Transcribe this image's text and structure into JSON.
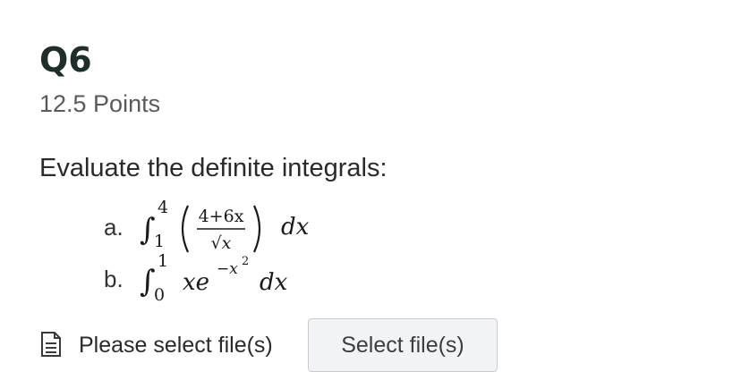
{
  "question": {
    "title": "Q6",
    "points": "12.5 Points",
    "prompt": "Evaluate the definite integrals:"
  },
  "items": [
    {
      "label": "a.",
      "expression": {
        "integral_symbol": "∫",
        "lower_limit": "1",
        "upper_limit": "4",
        "numerator": "4+6x",
        "denominator": "√x",
        "differential": "dx"
      }
    },
    {
      "label": "b.",
      "expression": {
        "integral_symbol": "∫",
        "lower_limit": "0",
        "upper_limit": "1",
        "integrand_base": "xe",
        "exponent": "−x",
        "exponent_power": "2",
        "differential": "dx"
      }
    }
  ],
  "upload": {
    "icon": "file-icon",
    "status": "Please select file(s)",
    "button_label": "Select file(s)"
  },
  "colors": {
    "title": "#1f2d2b",
    "button_bg": "#f2f3f5",
    "button_border": "#c9ccd1"
  }
}
